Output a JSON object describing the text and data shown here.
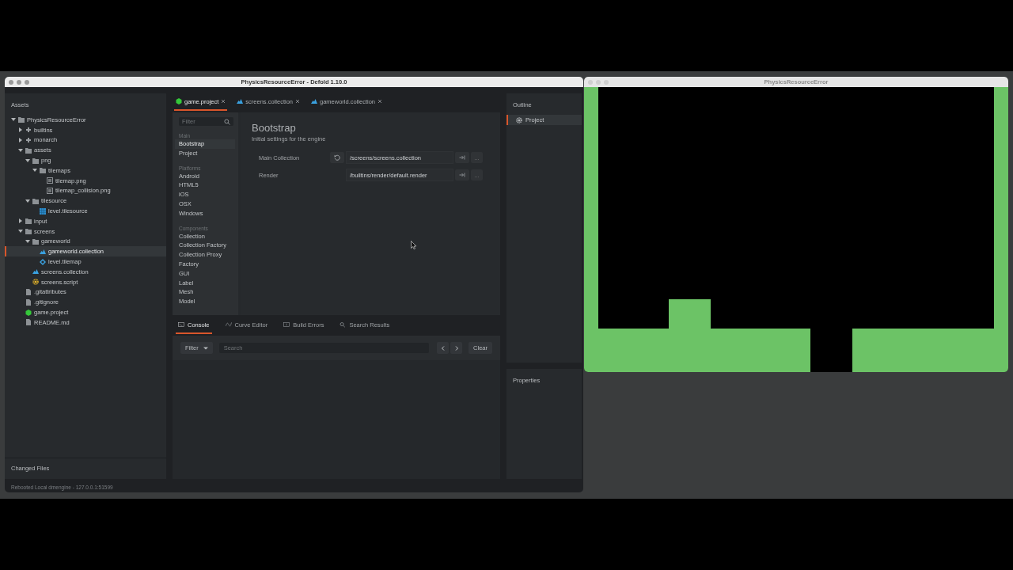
{
  "editor_window": {
    "title": "PhysicsResourceError - Defold 1.10.0",
    "assets": {
      "title": "Assets",
      "tree": [
        {
          "label": "PhysicsResourceError",
          "kind": "folder",
          "expanded": true,
          "selected": false,
          "children": [
            {
              "label": "builtins",
              "kind": "library",
              "expanded": false,
              "selected": false
            },
            {
              "label": "monarch",
              "kind": "library",
              "expanded": false,
              "selected": false
            },
            {
              "label": "assets",
              "kind": "folder",
              "expanded": true,
              "selected": false,
              "children": [
                {
                  "label": "png",
                  "kind": "folder",
                  "expanded": true,
                  "selected": false,
                  "children": [
                    {
                      "label": "tilemaps",
                      "kind": "folder",
                      "expanded": true,
                      "selected": false,
                      "children": [
                        {
                          "label": "tilemap.png",
                          "kind": "image",
                          "selected": false
                        },
                        {
                          "label": "tilemap_collision.png",
                          "kind": "image",
                          "selected": false
                        }
                      ]
                    }
                  ]
                },
                {
                  "label": "tilesource",
                  "kind": "folder",
                  "expanded": true,
                  "selected": false,
                  "children": [
                    {
                      "label": "level.tilesource",
                      "kind": "tilesource",
                      "selected": false
                    }
                  ]
                }
              ]
            },
            {
              "label": "input",
              "kind": "folder",
              "expanded": false,
              "selected": false
            },
            {
              "label": "screens",
              "kind": "folder",
              "expanded": true,
              "selected": false,
              "children": [
                {
                  "label": "gameworld",
                  "kind": "folder",
                  "expanded": true,
                  "selected": false,
                  "children": [
                    {
                      "label": "gameworld.collection",
                      "kind": "collection",
                      "selected": true
                    },
                    {
                      "label": "level.tilemap",
                      "kind": "tilemap",
                      "selected": false
                    }
                  ]
                },
                {
                  "label": "screens.collection",
                  "kind": "collection",
                  "selected": false
                },
                {
                  "label": "screens.script",
                  "kind": "script",
                  "selected": false
                }
              ]
            },
            {
              "label": ".gitattributes",
              "kind": "file",
              "selected": false
            },
            {
              "label": ".gitignore",
              "kind": "file",
              "selected": false
            },
            {
              "label": "game.project",
              "kind": "project",
              "selected": false
            },
            {
              "label": "README.md",
              "kind": "file",
              "selected": false
            }
          ]
        }
      ]
    },
    "changed_files": {
      "title": "Changed Files"
    },
    "editor_tabs": [
      {
        "label": "game.project",
        "kind": "project",
        "selected": true
      },
      {
        "label": "screens.collection",
        "kind": "collection",
        "selected": false
      },
      {
        "label": "gameworld.collection",
        "kind": "collection",
        "selected": false
      }
    ],
    "settings": {
      "filter": {
        "placeholder": "Filter"
      },
      "nav": [
        {
          "heading": "Main",
          "items": [
            {
              "label": "Bootstrap",
              "selected": true
            },
            {
              "label": "Project",
              "selected": false
            }
          ]
        },
        {
          "heading": "Platforms",
          "items": [
            {
              "label": "Android",
              "selected": false
            },
            {
              "label": "HTML5",
              "selected": false
            },
            {
              "label": "iOS",
              "selected": false
            },
            {
              "label": "OSX",
              "selected": false
            },
            {
              "label": "Windows",
              "selected": false
            }
          ]
        },
        {
          "heading": "Components",
          "items": [
            {
              "label": "Collection",
              "selected": false
            },
            {
              "label": "Collection Factory",
              "selected": false
            },
            {
              "label": "Collection Proxy",
              "selected": false
            },
            {
              "label": "Factory",
              "selected": false
            },
            {
              "label": "GUI",
              "selected": false
            },
            {
              "label": "Label",
              "selected": false
            },
            {
              "label": "Mesh",
              "selected": false
            },
            {
              "label": "Model",
              "selected": false
            }
          ]
        }
      ],
      "title": "Bootstrap",
      "subtitle": "Initial settings for the engine",
      "fields": [
        {
          "label": "Main Collection",
          "value": "/screens/screens.collection",
          "modified": true,
          "more": "..."
        },
        {
          "label": "Render",
          "value": "/builtins/render/default.render",
          "modified": false,
          "more": "..."
        }
      ]
    },
    "bottom_tabs": [
      {
        "label": "Console",
        "kind": "console",
        "selected": true
      },
      {
        "label": "Curve Editor",
        "kind": "curve",
        "selected": false
      },
      {
        "label": "Build Errors",
        "kind": "errors",
        "selected": false
      },
      {
        "label": "Search Results",
        "kind": "search",
        "selected": false
      }
    ],
    "console": {
      "filter": "Filter",
      "search": {
        "placeholder": "Search"
      },
      "clear": "Clear"
    },
    "outline": {
      "title": "Outline",
      "items": [
        {
          "label": "Project",
          "selected": true
        }
      ]
    },
    "properties": {
      "title": "Properties"
    },
    "status_bar": "Rebooted Local dmengine - 127.0.0.1:51599"
  },
  "game_window": {
    "title": "PhysicsResourceError"
  }
}
